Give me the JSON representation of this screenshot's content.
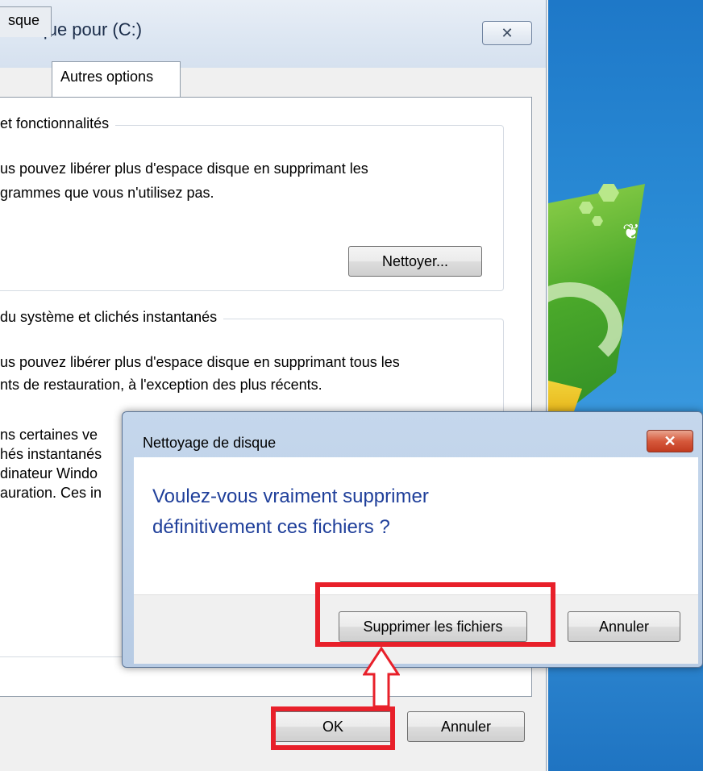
{
  "back_window": {
    "title": "e disque pour  (C:)",
    "close_glyph": "✕",
    "tabs": [
      "sque",
      "Autres options"
    ],
    "section1": {
      "title": "et fonctionnalités",
      "line1": "us pouvez libérer plus d'espace disque en supprimant les",
      "line2": "grammes que vous n'utilisez pas.",
      "button": "Nettoyer..."
    },
    "section2": {
      "title": "du système et clichés instantanés",
      "line1": "us pouvez libérer plus d'espace disque en supprimant tous les",
      "line2": "nts de restauration, à l'exception des plus récents.",
      "hidden1": "ns certaines ve",
      "hidden2": "hés instantanés",
      "hidden3": "dinateur Windo",
      "hidden4": "auration. Ces in"
    },
    "ok_label": "OK",
    "cancel_label": "Annuler"
  },
  "dialog": {
    "title": "Nettoyage de disque",
    "close_glyph": "✕",
    "message_line1": "Voulez-vous vraiment supprimer",
    "message_line2": "définitivement ces fichiers ?",
    "confirm_label": "Supprimer les fichiers",
    "cancel_label": "Annuler"
  },
  "colors": {
    "highlight": "#e8202a",
    "message_text": "#1f3f9a",
    "wallpaper": "#2c8fd8"
  }
}
